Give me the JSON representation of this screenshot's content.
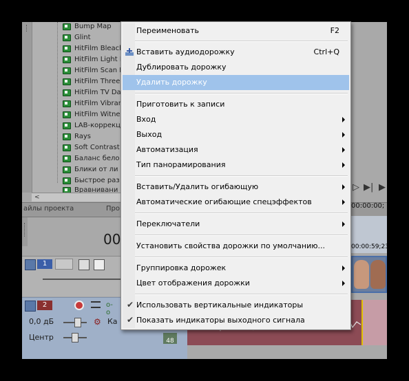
{
  "tree": {
    "items": [
      "Bump Map",
      "Glint",
      "HitFilm Bleach",
      "HitFilm Light F",
      "HitFilm Scan L",
      "HitFilm Three",
      "HitFilm TV Da",
      "HitFilm Vibran",
      "HitFilm Witne",
      "LAB-коррекц",
      "Rays",
      "Soft Contrast",
      "Баланс бело",
      "Блики от ли",
      "Быстрое раз",
      "Вравнивани"
    ]
  },
  "tabs": {
    "project_files": "айлы проекта",
    "second": "Про"
  },
  "timecode": "00",
  "right": {
    "time_top": "00:00:00;",
    "ruler_time": "00:00:59;23"
  },
  "track1": {
    "number": "1"
  },
  "track2": {
    "number": "2",
    "volume": "0,0 дБ",
    "pan": "Центр",
    "ks": "Ка",
    "pos_top": "",
    "pos_bottom": "48"
  },
  "menu": {
    "rename": "Переименовать",
    "rename_shortcut": "F2",
    "insert_audio": "Вставить аудиодорожку",
    "insert_audio_shortcut": "Ctrl+Q",
    "duplicate": "Дублировать дорожку",
    "delete": "Удалить дорожку",
    "prepare_record": "Приготовить к записи",
    "input": "Вход",
    "output": "Выход",
    "automation": "Автоматизация",
    "pan_type": "Тип панорамирования",
    "insert_remove_envelope": "Вставить/Удалить огибающую",
    "auto_fx_envelopes": "Автоматические огибающие спецэффектов",
    "switches": "Переключатели",
    "set_defaults": "Установить свойства дорожки по умолчанию...",
    "group": "Группировка дорожек",
    "color": "Цвет отображения дорожки",
    "vertical_meters": "Использовать вертикальные индикаторы",
    "output_meters": "Показать индикаторы выходного сигнала"
  },
  "colors": {
    "highlight": "#9fc3eb",
    "audio_clip": "#8c4b55",
    "track2_header": "#9fb0c8"
  }
}
